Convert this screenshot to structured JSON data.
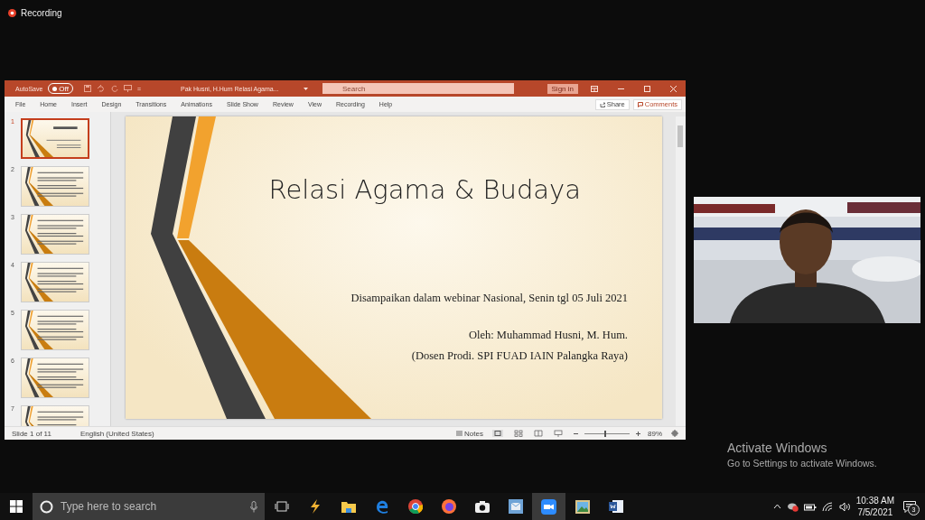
{
  "recording": {
    "label": "Recording"
  },
  "window": {
    "autosave": {
      "label": "AutoSave",
      "state_text": "Off",
      "on": false
    },
    "customize": "=",
    "title": "Pak Husni, H.Hum Relasi Agama...",
    "search": {
      "placeholder": "Search"
    },
    "sign_in": "Sign in"
  },
  "ribbon": {
    "tabs": [
      "File",
      "Home",
      "Insert",
      "Design",
      "Transitions",
      "Animations",
      "Slide Show",
      "Review",
      "View",
      "Recording",
      "Help"
    ],
    "share": "Share",
    "comments": "Comments"
  },
  "thumbnails": [
    {
      "number": "1",
      "selected": true,
      "kind": "title"
    },
    {
      "number": "2",
      "selected": false,
      "kind": "text"
    },
    {
      "number": "3",
      "selected": false,
      "kind": "text"
    },
    {
      "number": "4",
      "selected": false,
      "kind": "text"
    },
    {
      "number": "5",
      "selected": false,
      "kind": "text"
    },
    {
      "number": "6",
      "selected": false,
      "kind": "text"
    },
    {
      "number": "7",
      "selected": false,
      "kind": "text"
    }
  ],
  "slide": {
    "title": "Relasi Agama & Budaya",
    "lines": [
      "Disampaikan dalam webinar Nasional, Senin tgl 05 Juli 2021",
      "Oleh: Muhammad Husni, M. Hum.",
      "(Dosen Prodi. SPI FUAD IAIN Palangka Raya)"
    ]
  },
  "status_bar": {
    "slide": "Slide 1 of 11",
    "language": "English (United States)",
    "notes": "Notes",
    "zoom": {
      "level": 0.45
    },
    "zoom_text": "89%"
  },
  "activation": {
    "title": "Activate Windows",
    "text": "Go to Settings to activate Windows."
  },
  "taskbar": {
    "search": {
      "placeholder": "Type here to search"
    },
    "time": "10:38 AM",
    "date": "7/5/2021",
    "notifications": "3"
  }
}
